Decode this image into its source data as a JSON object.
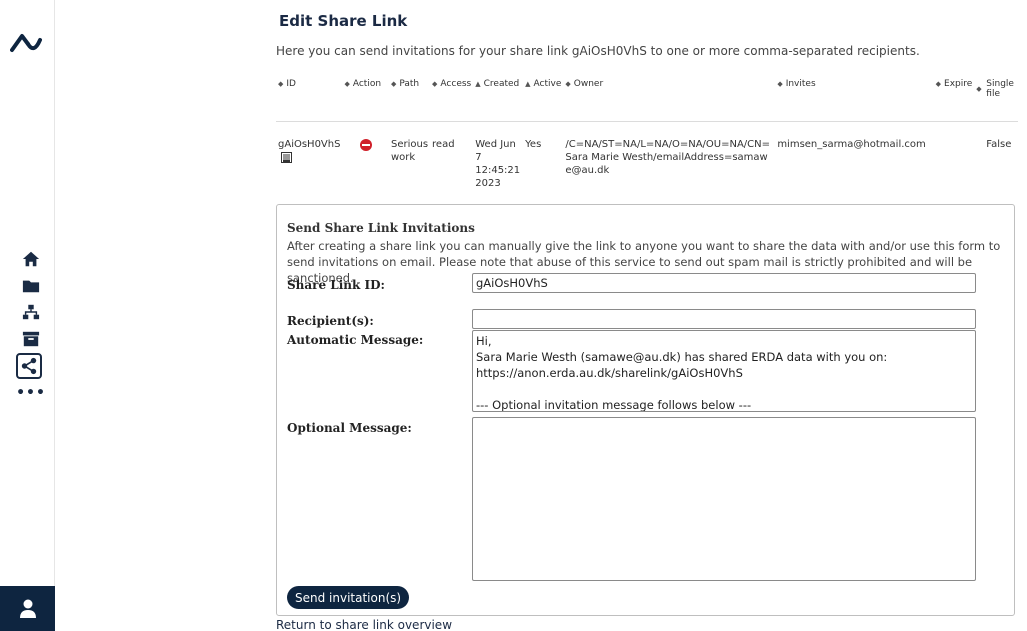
{
  "page": {
    "title": "Edit Share Link",
    "intro": "Here you can send invitations for your share link gAiOsH0VhS to one or more comma-separated recipients."
  },
  "table": {
    "headers": {
      "id": "ID",
      "action": "Action",
      "path": "Path",
      "access": "Access",
      "created": "Created",
      "active": "Active",
      "owner": "Owner",
      "invites": "Invites",
      "expire": "Expire",
      "single_file": "Single file"
    },
    "row": {
      "id": "gAiOsH0VhS",
      "path": "Serious work",
      "access": "read",
      "created": "Wed Jun 7 12:45:21 2023",
      "active": "Yes",
      "owner": "/C=NA/ST=NA/L=NA/O=NA/OU=NA/CN=Sara Marie Westh/emailAddress=samawe@au.dk",
      "invites": "mimsen_sarma@hotmail.com",
      "expire": "",
      "single_file": "False"
    }
  },
  "form": {
    "heading": "Send Share Link Invitations",
    "description": "After creating a share link you can manually give the link to anyone you want to share the data with and/or use this form to send invitations on email. Please note that abuse of this service to send out spam mail is strictly prohibited and will be sanctioned.",
    "share_link_id_label": "Share Link ID:",
    "share_link_id_value": "gAiOsH0VhS",
    "recipients_label": "Recipient(s):",
    "recipients_value": "",
    "auto_message_label": "Automatic Message:",
    "auto_message_value": "Hi,\nSara Marie Westh (samawe@au.dk) has shared ERDA data with you on:\nhttps://anon.erda.au.dk/sharelink/gAiOsH0VhS\n\n--- Optional invitation message follows below ---",
    "optional_message_label": "Optional Message:",
    "optional_message_value": "",
    "send_button": "Send invitation(s)"
  },
  "links": {
    "return": "Return to share link overview"
  },
  "sidebar": {
    "icons": [
      "home-icon",
      "folder-icon",
      "network-icon",
      "archive-icon",
      "share-icon",
      "more-icon",
      "user-icon"
    ],
    "more_label": "•••"
  },
  "colors": {
    "brand_dark": "#0e2540",
    "delete_red": "#d0202a"
  }
}
